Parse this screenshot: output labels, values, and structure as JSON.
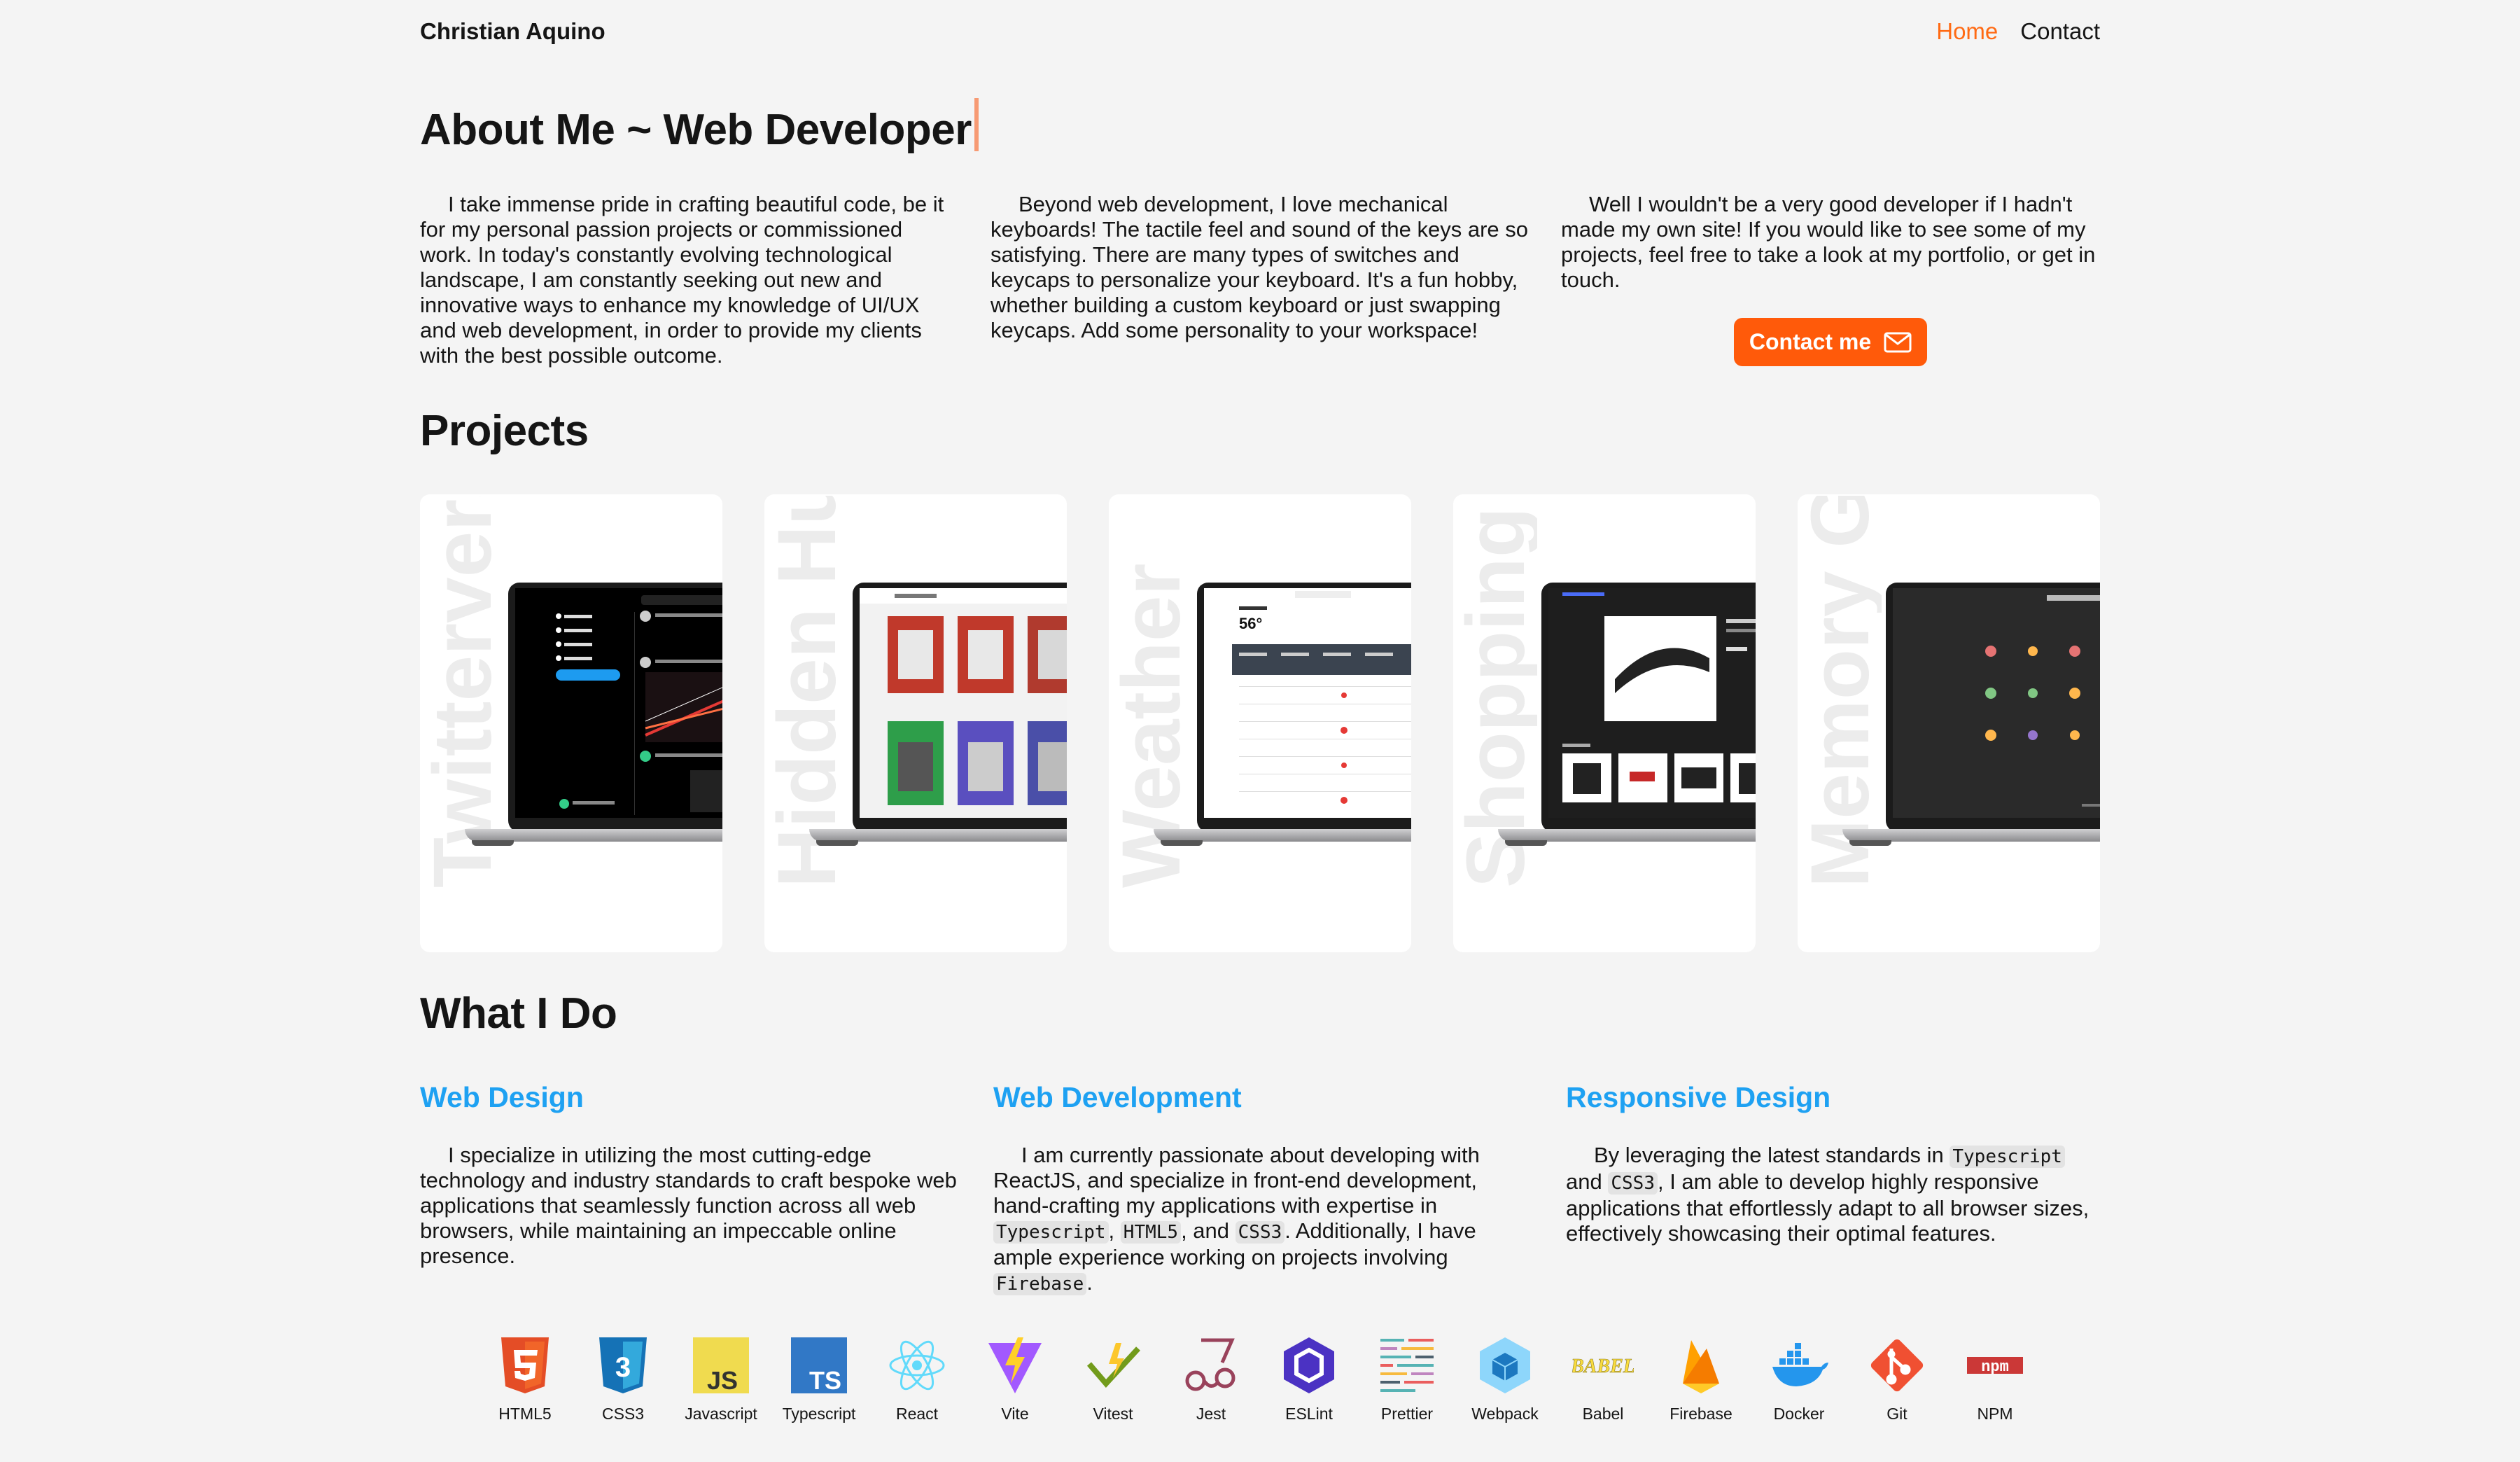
{
  "header": {
    "brand": "Christian Aquino",
    "nav": [
      {
        "label": "Home",
        "active": true
      },
      {
        "label": "Contact",
        "active": false
      }
    ]
  },
  "about": {
    "title": "About Me ~ Web Developer",
    "col1": "I take immense pride in crafting beautiful code, be it for my personal passion projects or commissioned work. In today's constantly evolving technological landscape, I am constantly seeking out new and innovative ways to enhance my knowledge of UI/UX and web development, in order to provide my clients with the best possible outcome.",
    "col2": "Beyond web development, I love mechanical keyboards! The tactile feel and sound of the keys are so satisfying. There are many types of switches and keycaps to personalize your keyboard. It's a fun hobby, whether building a custom keyboard or just swapping keycaps. Add some personality to your workspace!",
    "col3": "Well I wouldn't be a very good developer if I hadn't made my own site! If you would like to see some of my projects, feel free to take a look at my portfolio, or get in touch.",
    "contact_button": "Contact me"
  },
  "projects": {
    "title": "Projects",
    "items": [
      {
        "title": "Twitterverse",
        "theme": "dark"
      },
      {
        "title": "Hidden Hunt",
        "theme": "level"
      },
      {
        "title": "Weather",
        "theme": "weather"
      },
      {
        "title": "Shopping Cart",
        "theme": "shop"
      },
      {
        "title": "Memory Game",
        "theme": "memory"
      }
    ]
  },
  "what": {
    "title": "What I Do",
    "items": [
      {
        "heading": "Web Design",
        "text": "I specialize in utilizing the most cutting-edge technology and industry standards to craft bespoke web applications that seamlessly function across all web browsers, while maintaining an impeccable online presence."
      },
      {
        "heading": "Web Development",
        "text_a": "I am currently passionate about developing with ReactJS, and specialize in front-end development, hand-crafting my applications with expertise in",
        "code1": "Typescript",
        "sep1": ",",
        "code2": "HTML5",
        "sep2": ", and",
        "code3": "CSS3",
        "text_b": ". Additionally, I have ample experience working on projects involving",
        "code4": "Firebase",
        "text_c": "."
      },
      {
        "heading": "Responsive Design",
        "text_a": "By leveraging the latest standards in",
        "code1": "Typescript",
        "text_b": "and",
        "code2": "CSS3",
        "text_c": ", I am able to develop highly responsive applications that effortlessly adapt to all browser sizes, effectively showcasing their optimal features."
      }
    ]
  },
  "tech": [
    {
      "label": "HTML5",
      "icon": "html5-icon",
      "color": "#e44d26"
    },
    {
      "label": "CSS3",
      "icon": "css3-icon",
      "color": "#1572b6"
    },
    {
      "label": "Javascript",
      "icon": "javascript-icon",
      "color": "#f0db4f"
    },
    {
      "label": "Typescript",
      "icon": "typescript-icon",
      "color": "#3178c6"
    },
    {
      "label": "React",
      "icon": "react-icon",
      "color": "#61dafb"
    },
    {
      "label": "Vite",
      "icon": "vite-icon",
      "color": "#a259ff"
    },
    {
      "label": "Vitest",
      "icon": "vitest-icon",
      "color": "#6e9f18"
    },
    {
      "label": "Jest",
      "icon": "jest-icon",
      "color": "#99425b"
    },
    {
      "label": "ESLint",
      "icon": "eslint-icon",
      "color": "#4b32c3"
    },
    {
      "label": "Prettier",
      "icon": "prettier-icon",
      "color": "#56b3b4"
    },
    {
      "label": "Webpack",
      "icon": "webpack-icon",
      "color": "#8ed6fb"
    },
    {
      "label": "Babel",
      "icon": "babel-icon",
      "color": "#f9dc3e"
    },
    {
      "label": "Firebase",
      "icon": "firebase-icon",
      "color": "#ffa000"
    },
    {
      "label": "Docker",
      "icon": "docker-icon",
      "color": "#2496ed"
    },
    {
      "label": "Git",
      "icon": "git-icon",
      "color": "#f05032"
    },
    {
      "label": "NPM",
      "icon": "npm-icon",
      "color": "#cb3837"
    }
  ],
  "colors": {
    "accent": "#ff5a0a",
    "link": "#1ea1f2",
    "background": "#f4f4f4"
  }
}
